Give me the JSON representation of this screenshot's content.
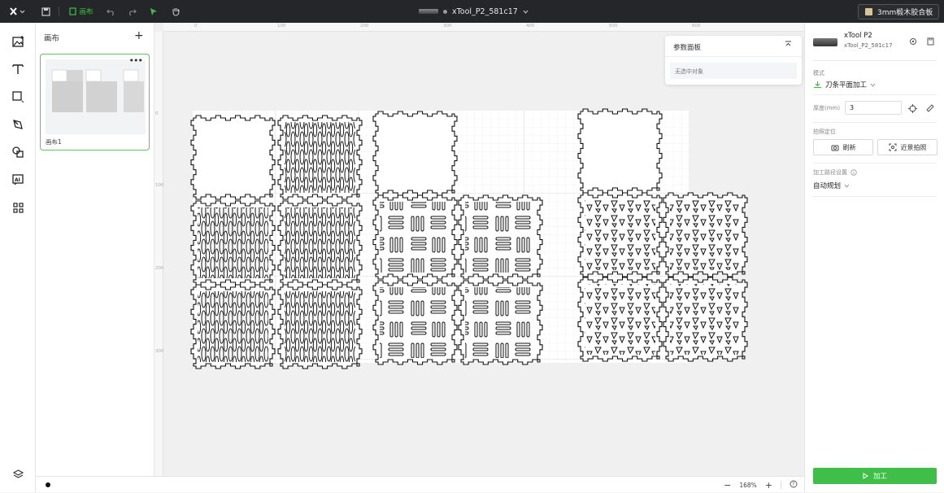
{
  "topbar": {
    "logo_icon": "xtool-logo-icon",
    "save_icon": "save-icon",
    "canvas_tab_label": "画布",
    "undo_icon": "undo-icon",
    "redo_icon": "redo-icon",
    "select_icon": "cursor-icon",
    "pan_icon": "hand-icon",
    "document_title": "xTool_P2_581c17",
    "material_label": "3mm椴木胶合板",
    "accent_color": "#3fbf4a"
  },
  "left_tools": [
    {
      "name": "image-tool",
      "icon": "image-icon"
    },
    {
      "name": "text-tool",
      "icon": "text-icon"
    },
    {
      "name": "shape-tool",
      "icon": "square-icon"
    },
    {
      "name": "pen-tool",
      "icon": "pen-icon"
    },
    {
      "name": "element-tool",
      "icon": "shapes-icon"
    },
    {
      "name": "ai-tool",
      "icon": "ai-icon"
    },
    {
      "name": "apps-tool",
      "icon": "apps-icon"
    }
  ],
  "pages": {
    "title": "画布",
    "items": [
      {
        "name": "画布1"
      }
    ]
  },
  "params_panel": {
    "title": "参数面板",
    "empty_text": "无选中对象"
  },
  "zoom": {
    "value": "168%"
  },
  "right_panel": {
    "device_name": "xTool P2",
    "device_id": "xTool_P2_581c17",
    "mode_label": "模式",
    "mode_value": "刀条平面加工",
    "thickness_label": "厚度(mm)",
    "thickness_value": "3",
    "camera_label": "拍照定位",
    "refresh_label": "刷新",
    "closeup_label": "近景拍照",
    "path_label": "加工路径设置",
    "path_value": "自动规划",
    "process_label": "加工"
  },
  "ruler": {
    "top_ticks": [
      "0",
      "100",
      "200",
      "300",
      "400",
      "500",
      "600"
    ],
    "left_ticks": [
      "0",
      "100",
      "200",
      "300"
    ]
  }
}
